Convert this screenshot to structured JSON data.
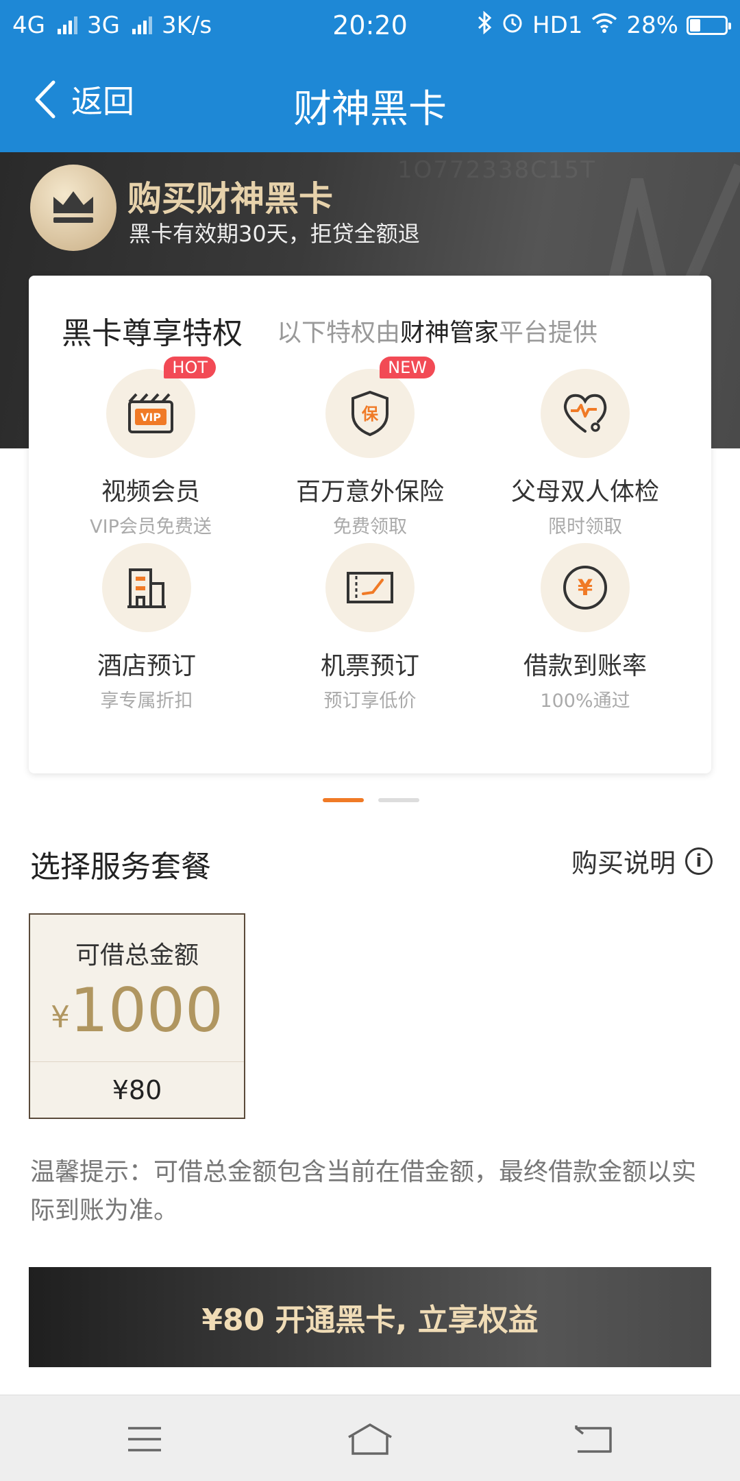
{
  "status_bar": {
    "network1": "4G",
    "network2": "3G",
    "speed": "3K/s",
    "time": "20:20",
    "hd": "HD1",
    "battery": "28%",
    "battery_level": 0.28
  },
  "nav": {
    "back_label": "返回",
    "title": "财神黑卡"
  },
  "banner": {
    "title": "购买财神黑卡",
    "subtitle": "黑卡有效期30天，拒贷全额退",
    "watermark": "1O772338C15T"
  },
  "privileges": {
    "title": "黑卡尊享特权",
    "subtitle_prefix": "以下特权由",
    "subtitle_highlight": "财神管家",
    "subtitle_suffix": "平台提供",
    "items": [
      {
        "label": "视频会员",
        "desc": "VIP会员免费送",
        "badge": "HOT",
        "icon": "vip-video-icon"
      },
      {
        "label": "百万意外保险",
        "desc": "免费领取",
        "badge": "NEW",
        "icon": "insurance-shield-icon"
      },
      {
        "label": "父母双人体检",
        "desc": "限时领取",
        "badge": "",
        "icon": "heart-stethoscope-icon"
      },
      {
        "label": "酒店预订",
        "desc": "享专属折扣",
        "badge": "",
        "icon": "hotel-building-icon"
      },
      {
        "label": "机票预订",
        "desc": "预订享低价",
        "badge": "",
        "icon": "plane-ticket-icon"
      },
      {
        "label": "借款到账率",
        "desc": "100%通过",
        "badge": "",
        "icon": "yuan-coin-icon"
      }
    ]
  },
  "section": {
    "title": "选择服务套餐",
    "purchase_info": "购买说明"
  },
  "package": {
    "label": "可借总金额",
    "currency": "¥",
    "amount": "1000",
    "price": "¥80"
  },
  "tip": "温馨提示：可借总金额包含当前在借金额，最终借款金额以实际到账为准。",
  "cta": "¥80 开通黑卡, 立享权益",
  "colors": {
    "brand_blue": "#1e88d6",
    "gold": "#b09660",
    "accent_orange": "#f07a26",
    "badge_red": "#f24a55"
  }
}
